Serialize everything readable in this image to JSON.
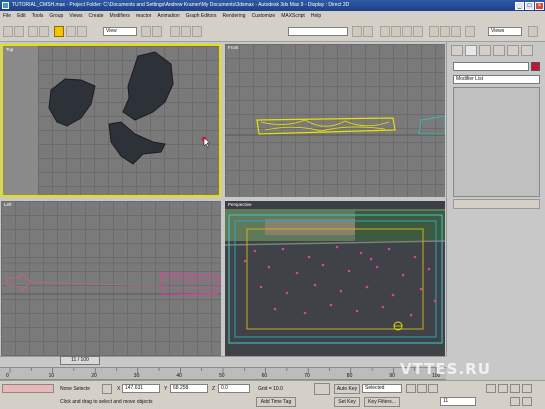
{
  "window": {
    "title": "TUTORIAL_CMSH.max  - Project Folder: C:\\Documents and Settings\\Andrew Kramer\\My Documents\\3dsmax  - Autodesk 3ds Max 9  - Display : Direct 3D",
    "minimize": "_",
    "maximize": "□",
    "close": "×"
  },
  "menu": [
    "File",
    "Edit",
    "Tools",
    "Group",
    "Views",
    "Create",
    "Modifiers",
    "reactor",
    "Animation",
    "Graph Editors",
    "Rendering",
    "Customize",
    "MAXScript",
    "Help"
  ],
  "toolbar": {
    "selection_filter": "All",
    "coord_system": "View",
    "named_selection": "",
    "view_select": "Views"
  },
  "viewports": {
    "top": {
      "label": "Top"
    },
    "front": {
      "label": "Front"
    },
    "left": {
      "label": "Left"
    },
    "perspective": {
      "label": "Perspective"
    }
  },
  "command_panel": {
    "modifier_list": "Modifier List"
  },
  "time_slider": {
    "position_label": "11 / 100",
    "ticks": [
      "0",
      "10",
      "20",
      "30",
      "40",
      "50",
      "60",
      "70",
      "80",
      "90",
      "100"
    ]
  },
  "status": {
    "selection": "None Selecte",
    "prompt": "Click and drag to select and move objects",
    "x_label": "X",
    "x_value": "147.631",
    "y_label": "Y",
    "y_value": "68.258",
    "z_label": "Z",
    "z_value": "0.0",
    "grid": "Grid = 10.0",
    "add_time_tag": "Add Time Tag",
    "auto_key": "Auto Key",
    "set_key": "Set Key",
    "key_mode": "Selected",
    "key_filters": "Key Filters...",
    "frame": "11"
  },
  "watermark": "VTTES.RU",
  "colors": {
    "selection_yellow": "#e8e000",
    "particle_pink": "#e040a0",
    "safe_frame_cyan": "#40c8c8",
    "title_blue": "#2f5aa6"
  }
}
